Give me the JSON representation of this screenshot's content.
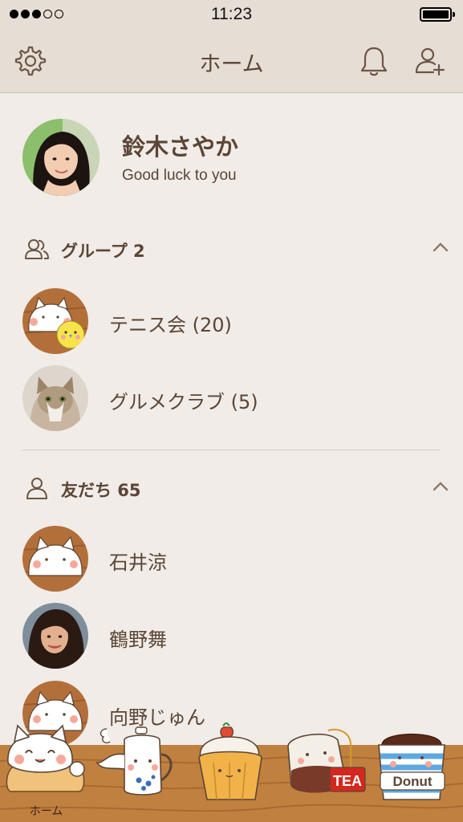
{
  "status_bar": {
    "time": "11:23"
  },
  "nav": {
    "title": "ホーム"
  },
  "profile": {
    "name": "鈴木さやか",
    "status": "Good luck to you"
  },
  "groups": {
    "title": "グループ 2",
    "items": [
      {
        "label": "テニス会 (20)"
      },
      {
        "label": "グルメクラブ (5)"
      }
    ]
  },
  "friends": {
    "title": "友だち 65",
    "items": [
      {
        "label": "石井涼"
      },
      {
        "label": "鶴野舞"
      },
      {
        "label": "向野じゅん"
      }
    ]
  },
  "tabs": [
    {
      "label": "ホーム",
      "icon": "bread-cat-icon"
    },
    {
      "label": "",
      "icon": "teapot-icon"
    },
    {
      "label": "",
      "icon": "cupcake-icon"
    },
    {
      "label": "",
      "icon": "tea-bag-icon"
    },
    {
      "label": "",
      "icon": "donut-cup-icon"
    }
  ],
  "tab_graphics": {
    "tea": "TEA",
    "donut": "Donut"
  },
  "colors": {
    "background": "#f1ece7",
    "nav": "#e6ddd4",
    "text": "#5b4536",
    "tabbar": "#c0803f"
  }
}
